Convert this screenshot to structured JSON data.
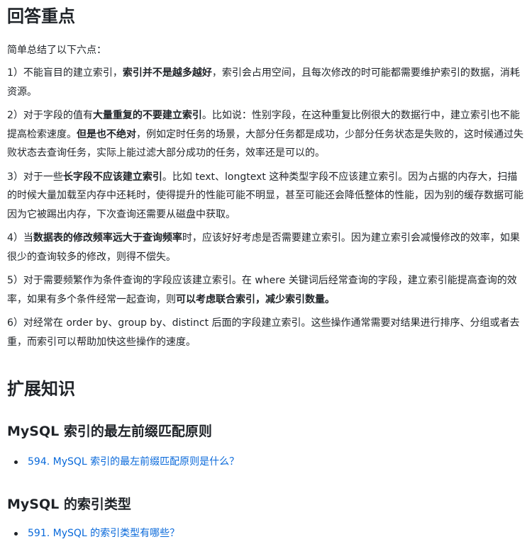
{
  "answer_heading": "回答重点",
  "intro": "简单总结了以下六点：",
  "points": {
    "p1": {
      "a": "1）不能盲目的建立索引，",
      "b": "索引并不是越多越好",
      "c": "，索引会占用空间，且每次修改的时可能都需要维护索引的数据，消耗资源。"
    },
    "p2": {
      "a": "2）对于字段的值有",
      "b": "大量重复的不要建立索引",
      "c": "。比如说：性别字段，在这种重复比例很大的数据行中，建立索引也不能提高检索速度。",
      "d": "但是也不绝对",
      "e": "，例如定时任务的场景，大部分任务都是成功，少部分任务状态是失败的，这时候通过失败状态去查询任务，实际上能过滤大部分成功的任务，效率还是可以的。"
    },
    "p3": {
      "a": "3）对于一些",
      "b": "长字段不应该建立索引",
      "c": "。比如 text、longtext 这种类型字段不应该建立索引。因为占据的内存大，扫描的时候大量加载至内存中还耗时，使得提升的性能可能不明显，甚至可能还会降低整体的性能，因为别的缓存数据可能因为它被踢出内存，下次查询还需要从磁盘中获取。"
    },
    "p4": {
      "a": "4）当",
      "b": "数据表的修改频率远大于查询频率",
      "c": "时，应该好好考虑是否需要建立索引。因为建立索引会减慢修改的效率，如果很少的查询较多的修改，则得不偿失。"
    },
    "p5": {
      "a": "5）对于需要频繁作为条件查询的字段应该建立索引。在 where 关键词后经常查询的字段，建立索引能提高查询的效率，如果有多个条件经常一起查询，则",
      "b": "可以考虑联合索引，减少索引数量。"
    },
    "p6": {
      "a": "6）对经常在 order by、group by、distinct 后面的字段建立索引。这些操作通常需要对结果进行排序、分组或者去重，而索引可以帮助加快这些操作的速度。"
    }
  },
  "extension_heading": "扩展知识",
  "sections": [
    {
      "heading": "MySQL 索引的最左前缀匹配原则",
      "link": "594. MySQL 索引的最左前缀匹配原则是什么？"
    },
    {
      "heading": "MySQL 的索引类型",
      "link": "591. MySQL 的索引类型有哪些？"
    }
  ],
  "colors": {
    "text": "#1f2328",
    "link": "#0969da"
  }
}
